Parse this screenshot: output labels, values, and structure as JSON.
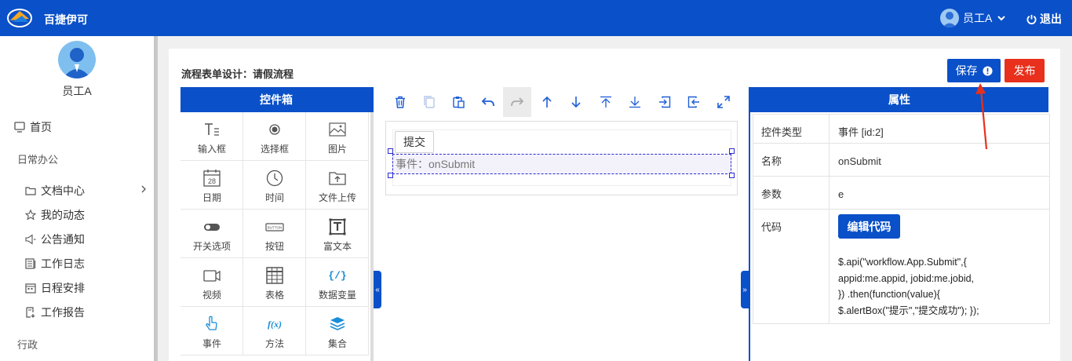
{
  "topbar": {
    "brand": "百捷伊可",
    "user_name": "员工A",
    "logout_label": "退出",
    "color": "#0a50c8"
  },
  "sidebar": {
    "user_name": "员工A",
    "home": "首页",
    "group_office": "日常办公",
    "items": [
      {
        "label": "文档中心",
        "icon": "folder-icon"
      },
      {
        "label": "我的动态",
        "icon": "star-icon"
      },
      {
        "label": "公告通知",
        "icon": "speaker-icon"
      },
      {
        "label": "工作日志",
        "icon": "log-icon"
      },
      {
        "label": "日程安排",
        "icon": "calendar-icon"
      },
      {
        "label": "工作报告",
        "icon": "report-icon"
      }
    ],
    "group_admin": "行政"
  },
  "page": {
    "title": "流程表单设计：请假流程",
    "save_label": "保存",
    "publish_label": "发布"
  },
  "controls": {
    "title": "控件箱",
    "items": [
      {
        "label": "输入框",
        "icon": "text-input-icon"
      },
      {
        "label": "选择框",
        "icon": "radio-icon"
      },
      {
        "label": "图片",
        "icon": "image-icon"
      },
      {
        "label": "日期",
        "icon": "calendar-date-icon"
      },
      {
        "label": "时间",
        "icon": "clock-icon"
      },
      {
        "label": "文件上传",
        "icon": "folder-upload-icon"
      },
      {
        "label": "开关选项",
        "icon": "toggle-icon"
      },
      {
        "label": "按钮",
        "icon": "button-icon"
      },
      {
        "label": "富文本",
        "icon": "rich-text-icon"
      },
      {
        "label": "视频",
        "icon": "video-icon"
      },
      {
        "label": "表格",
        "icon": "table-icon"
      },
      {
        "label": "数据变量",
        "icon": "variable-icon"
      },
      {
        "label": "事件",
        "icon": "pointer-icon"
      },
      {
        "label": "方法",
        "icon": "function-icon"
      },
      {
        "label": "集合",
        "icon": "layers-icon"
      }
    ],
    "date_icon_number": "28",
    "variable_icon_text": "{/}",
    "function_icon_text": "f(x)",
    "button_icon_text": "BUTTON"
  },
  "toolbar": {
    "icons": [
      "trash-icon",
      "copy-icon",
      "paste-icon",
      "undo-icon",
      "redo-icon",
      "arrow-up-icon",
      "arrow-down-icon",
      "move-top-icon",
      "move-bottom-icon",
      "import-icon",
      "export-icon",
      "fullscreen-icon"
    ]
  },
  "canvas": {
    "submit_label": "提交",
    "event_text": "事件：onSubmit"
  },
  "properties": {
    "title": "属性",
    "type_key": "控件类型",
    "type_value": "事件 [id:2]",
    "name_key": "名称",
    "name_value": "onSubmit",
    "param_key": "参数",
    "param_value": "e",
    "code_key": "代码",
    "edit_code_label": "编辑代码",
    "code_lines": [
      "$.api(\"workflow.App.Submit\",{",
      "appid:me.appid, jobid:me.jobid,",
      "}) .then(function(value){",
      "$.alertBox(\"提示\",\"提交成功\"); });"
    ]
  }
}
